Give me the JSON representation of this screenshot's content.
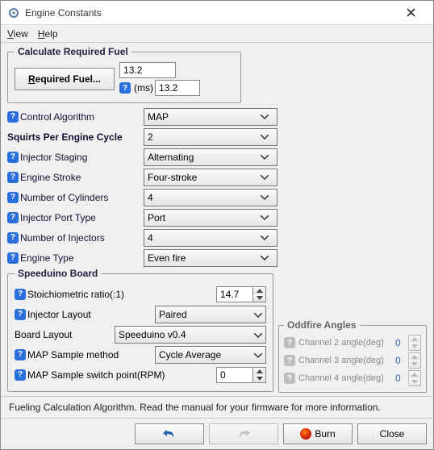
{
  "window": {
    "title": "Engine Constants"
  },
  "menu": {
    "view": "View",
    "help": "Help"
  },
  "reqfuel": {
    "legend": "Calculate Required Fuel",
    "button": "Required Fuel...",
    "value": "13.2",
    "ms_label": "(ms)",
    "ms_value": "13.2"
  },
  "fields": {
    "control_algorithm": {
      "label": "Control Algorithm",
      "value": "MAP"
    },
    "squirts_per_cycle": {
      "label": "Squirts Per Engine Cycle",
      "value": "2"
    },
    "injector_staging": {
      "label": "Injector Staging",
      "value": "Alternating"
    },
    "engine_stroke": {
      "label": "Engine Stroke",
      "value": "Four-stroke"
    },
    "num_cylinders": {
      "label": "Number of Cylinders",
      "value": "4"
    },
    "injector_port_type": {
      "label": "Injector Port Type",
      "value": "Port"
    },
    "num_injectors": {
      "label": "Number of Injectors",
      "value": "4"
    },
    "engine_type": {
      "label": "Engine Type",
      "value": "Even fire"
    }
  },
  "speeduino": {
    "legend": "Speeduino Board",
    "stoich": {
      "label": "Stoichiometric ratio(:1)",
      "value": "14.7"
    },
    "inj_layout": {
      "label": "Injector Layout",
      "value": "Paired"
    },
    "board_layout": {
      "label": "Board Layout",
      "value": "Speeduino v0.4"
    },
    "map_sample": {
      "label": "MAP Sample method",
      "value": "Cycle Average"
    },
    "map_switch": {
      "label": "MAP Sample switch point(RPM)",
      "value": "0"
    }
  },
  "oddfire": {
    "legend": "Oddfire Angles",
    "ch2": {
      "label": "Channel 2 angle(deg)",
      "value": "0"
    },
    "ch3": {
      "label": "Channel 3 angle(deg)",
      "value": "0"
    },
    "ch4": {
      "label": "Channel 4 angle(deg)",
      "value": "0"
    }
  },
  "status": "Fueling Calculation Algorithm. Read the manual for your firmware for more information.",
  "buttons": {
    "burn": "Burn",
    "close": "Close"
  }
}
